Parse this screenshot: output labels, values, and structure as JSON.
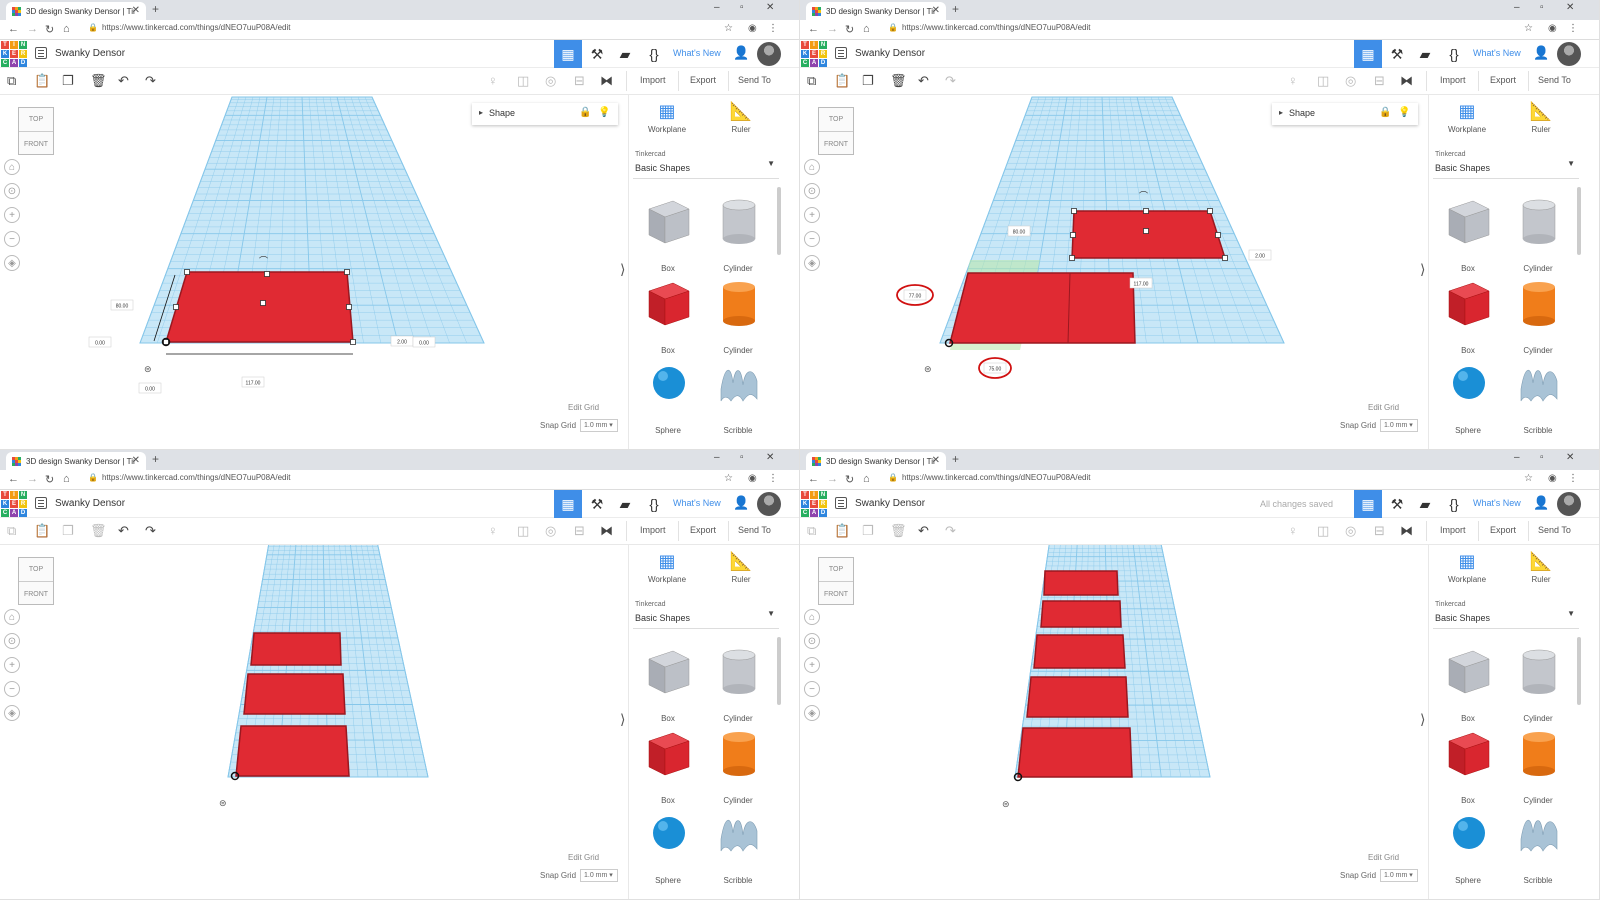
{
  "browser": {
    "tab_title": "3D design Swanky Densor | Tinkercad",
    "tab_close": "✕",
    "tab_new": "+",
    "url": "https://www.tinkercad.com/things/dNEO7uuP08A/edit",
    "min": "–",
    "max": "▫",
    "close": "✕"
  },
  "app": {
    "title": "Swanky Densor",
    "saved_status": "All changes saved",
    "whats_new": "What's New",
    "logo_letters": [
      "T",
      "I",
      "N",
      "K",
      "E",
      "R",
      "C",
      "A",
      "D"
    ],
    "logo_colors": [
      "#e84a3c",
      "#f39c12",
      "#27ae60",
      "#2e86de",
      "#e84a3c",
      "#f1c40f",
      "#27ae60",
      "#8e44ad",
      "#2e86de"
    ]
  },
  "toolbar": {
    "import": "Import",
    "export": "Export",
    "send_to": "Send To"
  },
  "viewport": {
    "viewcube_top": "TOP",
    "viewcube_front": "FRONT",
    "edit_grid": "Edit Grid",
    "snap_grid": "Snap Grid",
    "snap_value": "1.0 mm ▾",
    "shape_panel": "Shape"
  },
  "library": {
    "workplane": "Workplane",
    "ruler": "Ruler",
    "source": "Tinkercad",
    "category": "Basic Shapes",
    "items": [
      "Box",
      "Cylinder",
      "Box",
      "Cylinder",
      "Sphere",
      "Scribble"
    ]
  },
  "dimensions": {
    "p0": {
      "width": "117.00",
      "depth": "80.00",
      "height": "2.00",
      "x": "0.00",
      "y": "0.00",
      "elev": "0.00"
    },
    "p1": {
      "width": "117.00",
      "depth": "80.00",
      "height": "2.00",
      "x": "77.00",
      "y": "75.00",
      "elev": "0.00"
    }
  },
  "colors": {
    "accent": "#3f8ee8",
    "grid": "#a9d8f2",
    "shape_red": "#e02a33",
    "box_gray": "#b8bcc4",
    "cylinder_orange": "#f07d1a",
    "sphere_blue": "#1a8fd6",
    "annotation_red": "#d01010"
  },
  "panes": [
    {
      "id": "p0",
      "saved": false,
      "shape_panel": true,
      "redo_enabled": true
    },
    {
      "id": "p1",
      "saved": false,
      "shape_panel": true,
      "redo_enabled": false
    },
    {
      "id": "p2",
      "saved": false,
      "shape_panel": false,
      "redo_enabled": true
    },
    {
      "id": "p3",
      "saved": true,
      "shape_panel": false,
      "redo_enabled": false
    }
  ]
}
